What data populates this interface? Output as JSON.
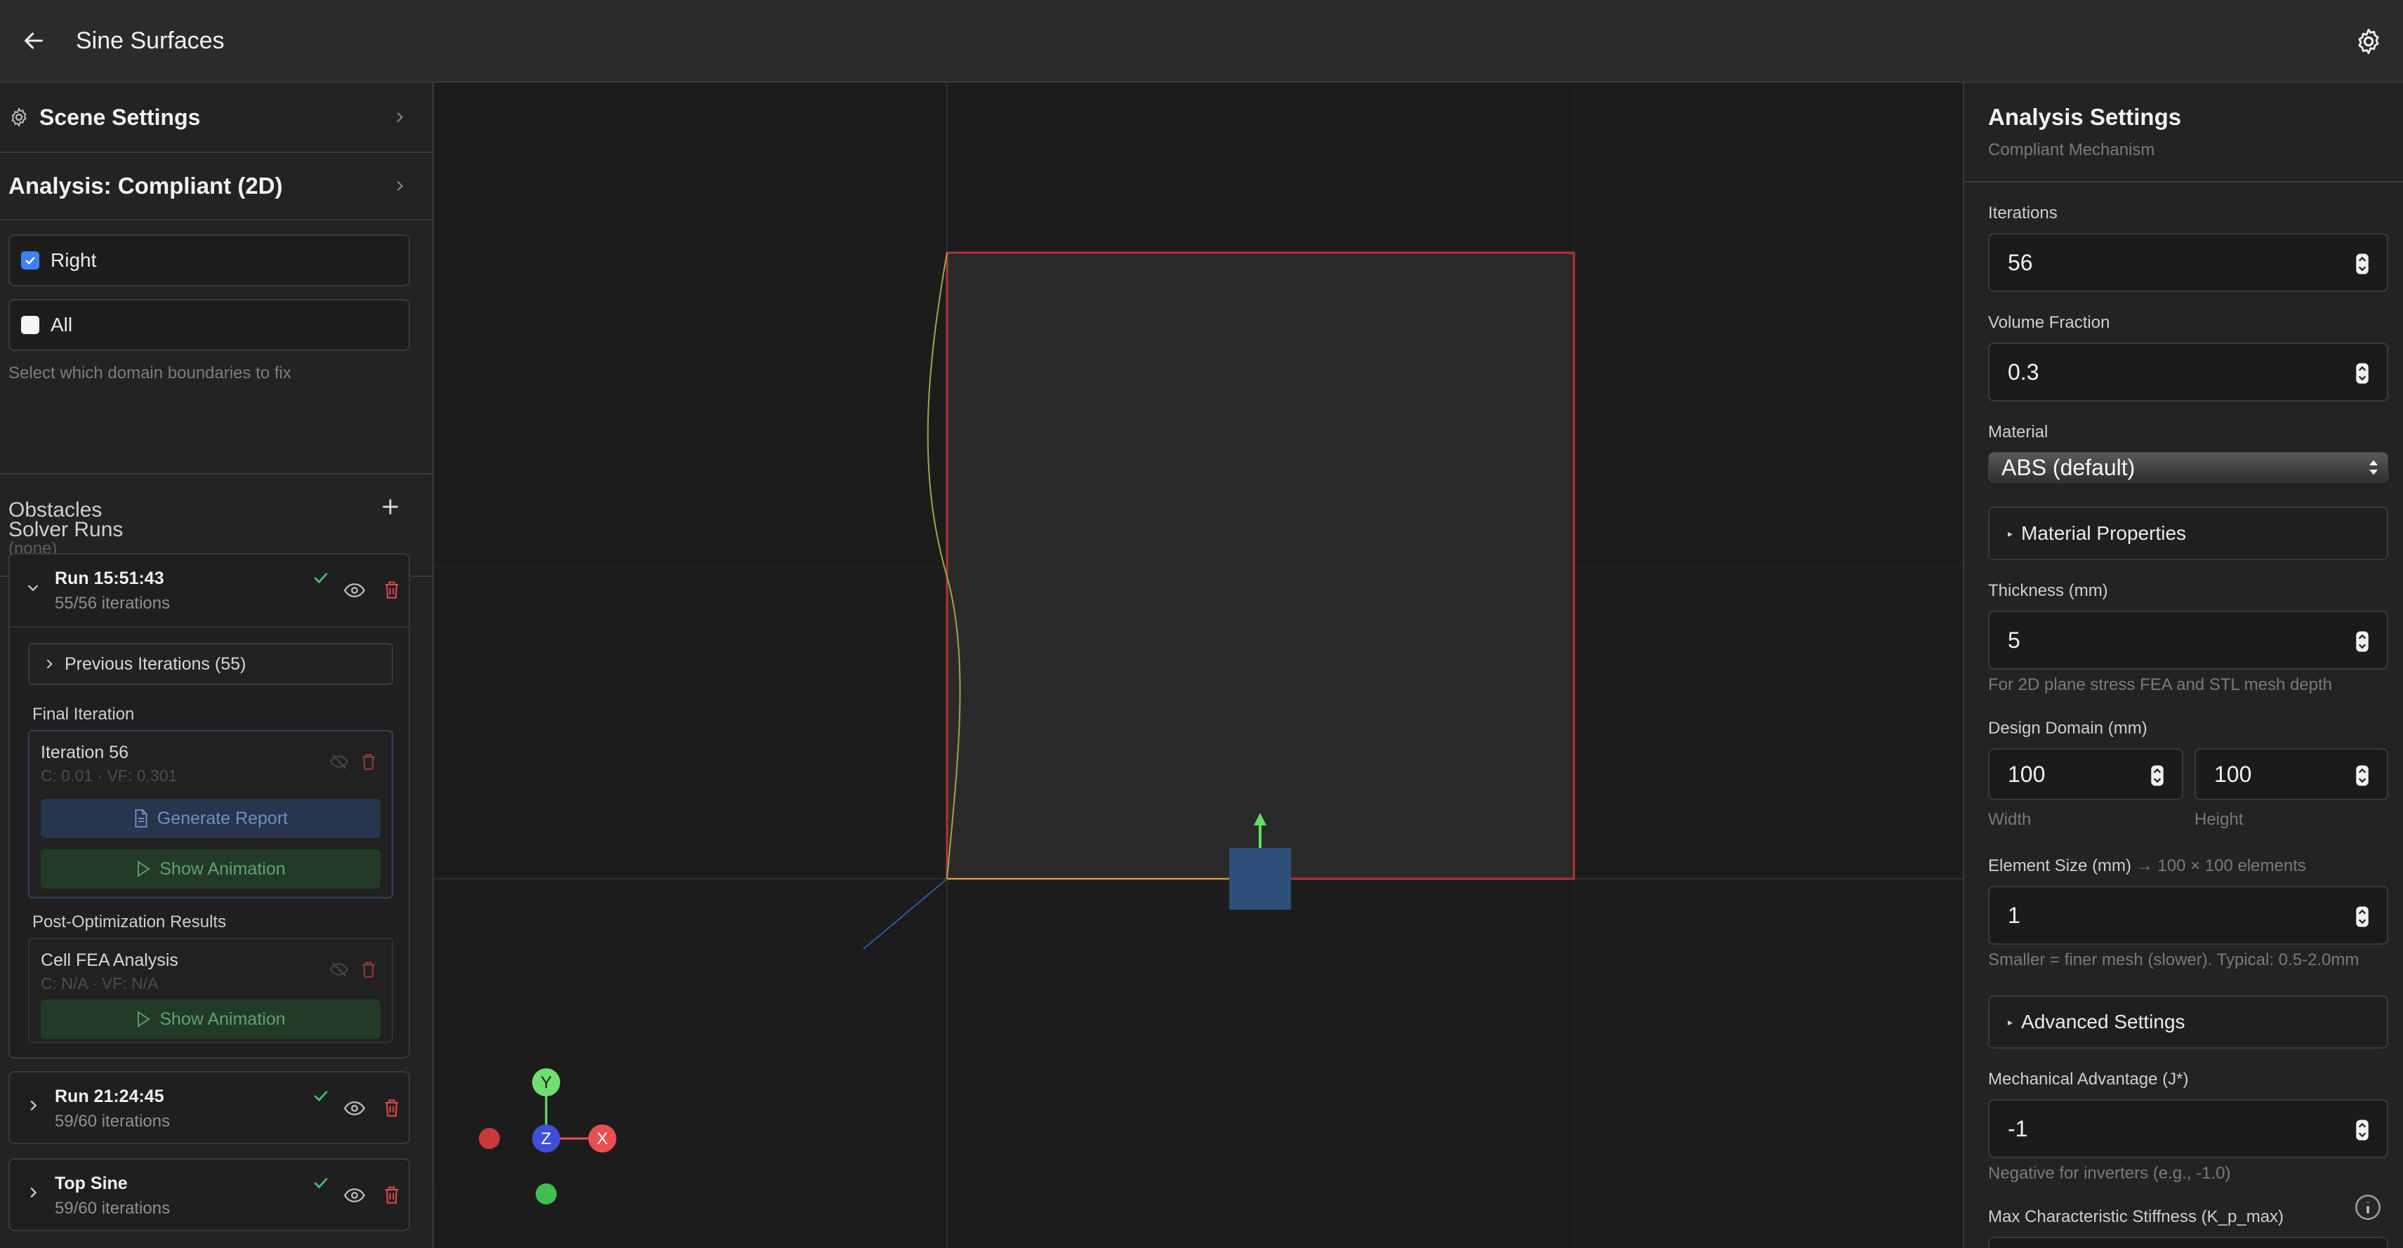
{
  "app": {
    "title": "Sine Surfaces"
  },
  "left": {
    "scene_settings": "Scene Settings",
    "analysis": "Analysis: Compliant (2D)",
    "boundaries": [
      {
        "label": "Right",
        "checked": true
      },
      {
        "label": "All",
        "checked": false
      }
    ],
    "boundaries_hint": "Select which domain boundaries to fix",
    "obstacles_label": "Obstacles",
    "obstacles_value": "(none)",
    "solver_runs_label": "Solver Runs",
    "runs": [
      {
        "name": "Run 15:51:43",
        "sub": "55/56 iterations",
        "expanded": true,
        "previous": "Previous Iterations (55)",
        "final_label": "Final Iteration",
        "final_name": "Iteration 56",
        "final_stats": "C: 0.01 · VF: 0.301",
        "report_btn": "Generate Report",
        "anim_btn": "Show Animation",
        "post_label": "Post-Optimization Results",
        "post_name": "Cell FEA Analysis",
        "post_stats": "C: N/A · VF: N/A",
        "post_anim_btn": "Show Animation"
      },
      {
        "name": "Run 21:24:45",
        "sub": "59/60 iterations",
        "expanded": false
      },
      {
        "name": "Top Sine",
        "sub": "59/60 iterations",
        "expanded": false
      }
    ]
  },
  "viewport": {
    "axes": {
      "x": "X",
      "y": "Y",
      "z": "Z"
    },
    "colors": {
      "domain_border": "#b83232",
      "load_block": "#2d4f7a",
      "arrow": "#5fe05f",
      "curve": "#9da84a"
    }
  },
  "right": {
    "title": "Analysis Settings",
    "subtitle": "Compliant Mechanism",
    "iterations_label": "Iterations",
    "iterations": "56",
    "volume_label": "Volume Fraction",
    "volume": "0.3",
    "material_label": "Material",
    "material": "ABS (default)",
    "material_props": "Material Properties",
    "thickness_label": "Thickness (mm)",
    "thickness": "5",
    "thickness_hint": "For 2D plane stress FEA and STL mesh depth",
    "domain_label": "Design Domain (mm)",
    "width": "100",
    "height": "100",
    "width_label": "Width",
    "height_label": "Height",
    "element_label": "Element Size (mm)",
    "element_note": "→ 100 × 100 elements",
    "element": "1",
    "element_hint": "Smaller = finer mesh (slower). Typical: 0.5-2.0mm",
    "advanced": "Advanced Settings",
    "mech_label": "Mechanical Advantage (J*)",
    "mech": "-1",
    "mech_hint": "Negative for inverters (e.g., -1.0)",
    "stiff_label": "Max Characteristic Stiffness (K_p_max)"
  }
}
